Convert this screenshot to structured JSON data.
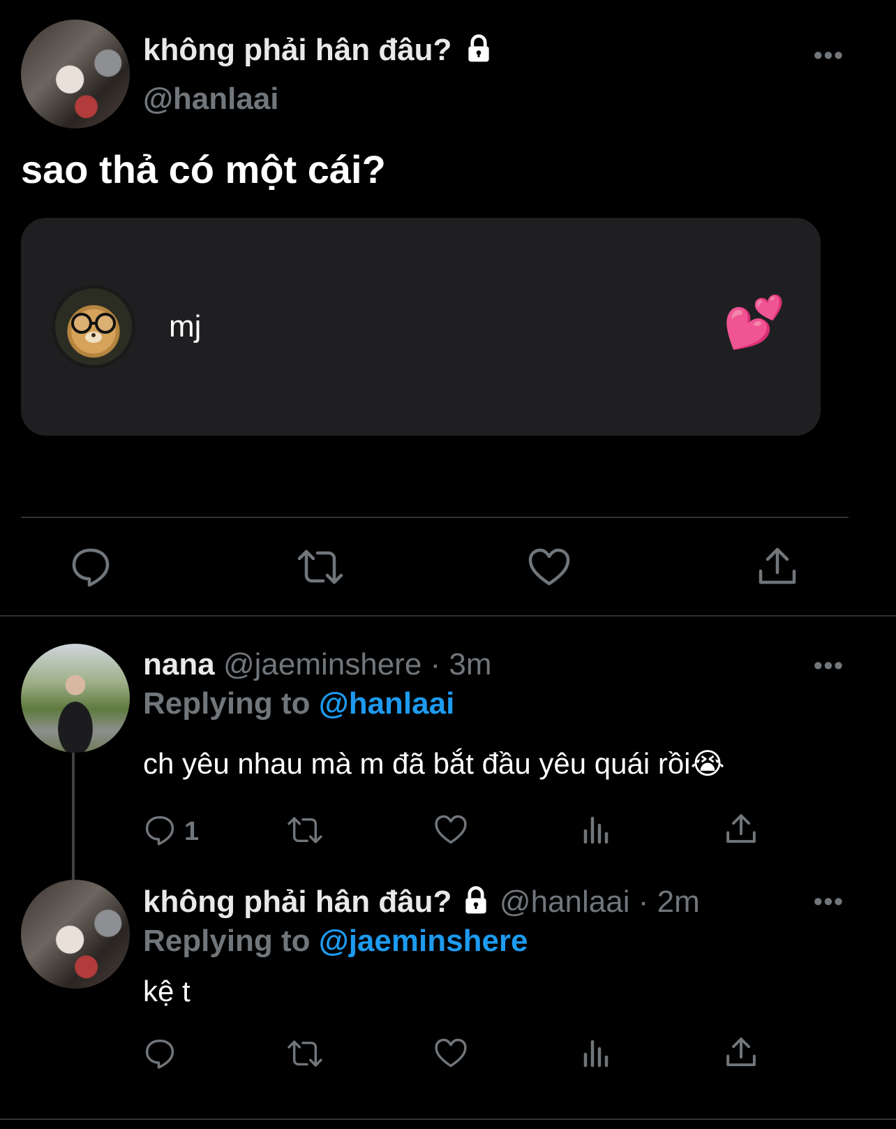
{
  "main_tweet": {
    "display_name": "không phải hân đâu?",
    "handle": "@hanlaai",
    "text": "sao thả có một cái?",
    "media_card": {
      "username": "mj",
      "emoji": "💕"
    }
  },
  "replies": [
    {
      "display_name": "nana",
      "handle": "@jaeminshere",
      "time": "· 3m",
      "replying_prefix": "Replying to",
      "replying_to": "@hanlaai",
      "text": "ch yêu nhau mà m đã bắt đầu yêu quái rồi😭",
      "reply_count": "1"
    },
    {
      "display_name": "không phải hân đâu?",
      "handle": "@hanlaai",
      "time": "· 2m",
      "replying_prefix": "Replying to",
      "replying_to": "@jaeminshere",
      "text": "kệ t",
      "reply_count": ""
    }
  ],
  "icons": {
    "lock": "lock-icon",
    "more": "more-icon",
    "reply": "reply-icon",
    "retweet": "retweet-icon",
    "like": "heart-icon",
    "views": "views-icon",
    "share": "share-icon"
  },
  "colors": {
    "background": "#000000",
    "text": "#e7e9ea",
    "muted": "#71767b",
    "link": "#1d9bf0",
    "card": "#1f1f22"
  }
}
